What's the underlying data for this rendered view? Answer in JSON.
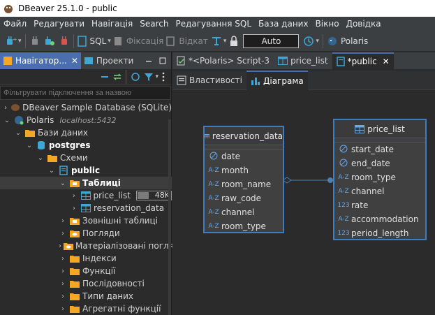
{
  "window": {
    "title": "DBeaver 25.1.0 - public"
  },
  "menu": [
    "Файл",
    "Редагувати",
    "Навігація",
    "Search",
    "Редагування SQL",
    "База даних",
    "Вікно",
    "Довідка"
  ],
  "toolbar": {
    "sql_label": "SQL",
    "commit_label": "Фіксація",
    "rollback_label": "Відкат",
    "mode_value": "Auto",
    "connection_label": "Polaris"
  },
  "navigator": {
    "tabs": [
      {
        "label": "Навігатор...",
        "close": "✕"
      },
      {
        "label": "Проекти"
      }
    ],
    "filter_placeholder": "Фільтрувати підключення за назвою",
    "tree": [
      {
        "label": "DBeaver Sample Database (SQLite)"
      },
      {
        "label": "Polaris",
        "hint": "localhost:5432"
      },
      {
        "label": "Бази даних"
      },
      {
        "label": "postgres"
      },
      {
        "label": "Схеми"
      },
      {
        "label": "public"
      },
      {
        "label": "Таблиці"
      },
      {
        "label": "price_list",
        "size": "48K",
        "size_fraction": 0.33
      },
      {
        "label": "reservation_data"
      },
      {
        "label": "Зовнішні таблиці"
      },
      {
        "label": "Погляди"
      },
      {
        "label": "Матеріалізовані погляди"
      },
      {
        "label": "Індекси"
      },
      {
        "label": "Функції"
      },
      {
        "label": "Послідовності"
      },
      {
        "label": "Типи даних"
      },
      {
        "label": "Агрегатні функції"
      }
    ]
  },
  "editor": {
    "tabs": [
      {
        "label": "*<Polaris> Script-3"
      },
      {
        "label": "price_list"
      },
      {
        "label": "*public",
        "close": "✕"
      }
    ],
    "subtabs": [
      {
        "label": "Властивості"
      },
      {
        "label": "Діаграма"
      }
    ]
  },
  "diagram": {
    "entities": [
      {
        "name": "reservation_data",
        "attributes": [
          {
            "type": "date",
            "name": "date"
          },
          {
            "type": "A-Z",
            "name": "month"
          },
          {
            "type": "A-Z",
            "name": "room_name"
          },
          {
            "type": "A-Z",
            "name": "raw_code"
          },
          {
            "type": "A-Z",
            "name": "channel"
          },
          {
            "type": "A-Z",
            "name": "room_type"
          }
        ]
      },
      {
        "name": "price_list",
        "attributes": [
          {
            "type": "date",
            "name": "start_date"
          },
          {
            "type": "date",
            "name": "end_date"
          },
          {
            "type": "A-Z",
            "name": "room_type"
          },
          {
            "type": "A-Z",
            "name": "channel"
          },
          {
            "type": "123",
            "name": "rate"
          },
          {
            "type": "A-Z",
            "name": "accommodation"
          },
          {
            "type": "123",
            "name": "period_length"
          }
        ]
      }
    ]
  },
  "colors": {
    "accent": "#4b6eaf",
    "entity_border": "#3d7ec2",
    "folder": "#f5a623"
  }
}
